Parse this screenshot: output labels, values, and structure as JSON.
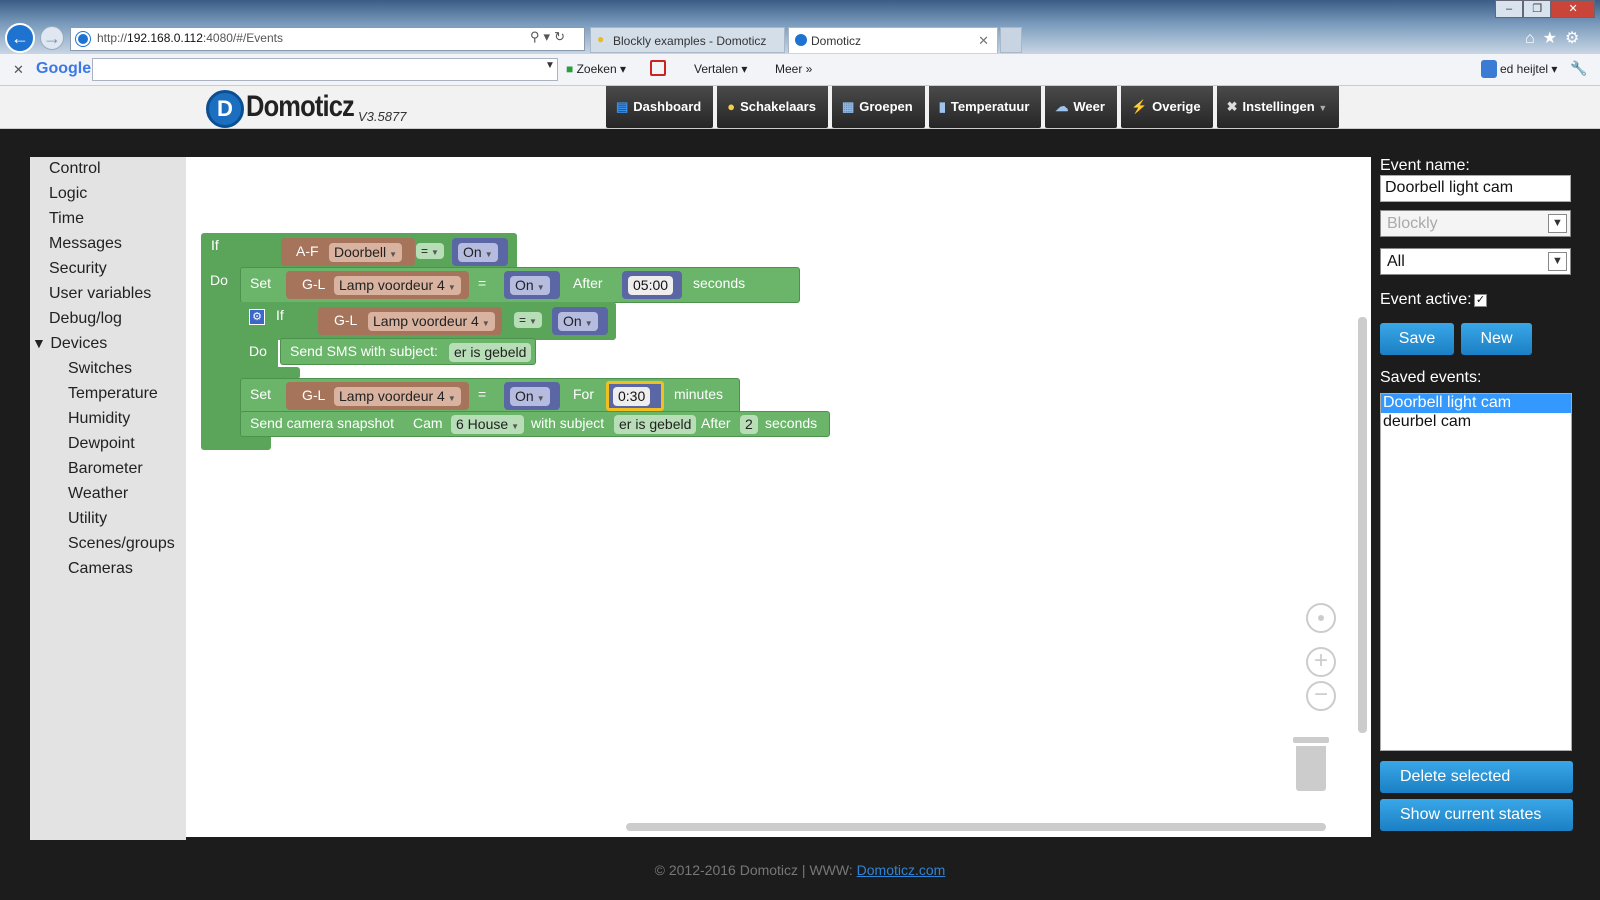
{
  "browser": {
    "url_prefix": "http://",
    "url_host": "192.168.0.112",
    "url_rest": ":4080/#/Events",
    "tabs": [
      {
        "label": "Blockly examples - Domoticz"
      },
      {
        "label": "Domoticz"
      }
    ],
    "toolbar": {
      "google": "Google",
      "zoeken": "Zoeken",
      "vertalen": "Vertalen",
      "meer": "Meer",
      "user": "ed heijtel"
    }
  },
  "app": {
    "logo": "Domoticz",
    "version": "V3.5877",
    "nav": [
      {
        "label": "Dashboard",
        "icon": "dashboard-icon"
      },
      {
        "label": "Schakelaars",
        "icon": "lightbulb-icon"
      },
      {
        "label": "Groepen",
        "icon": "groups-icon"
      },
      {
        "label": "Temperatuur",
        "icon": "thermometer-icon"
      },
      {
        "label": "Weer",
        "icon": "weather-icon"
      },
      {
        "label": "Overige",
        "icon": "utility-icon"
      },
      {
        "label": "Instellingen",
        "icon": "settings-icon"
      }
    ]
  },
  "sidebar": {
    "categories": [
      "Control",
      "Logic",
      "Time",
      "Messages",
      "Security",
      "User variables",
      "Debug/log",
      "Devices"
    ],
    "devices": [
      "Switches",
      "Temperature",
      "Humidity",
      "Dewpoint",
      "Barometer",
      "Weather",
      "Utility",
      "Scenes/groups",
      "Cameras"
    ]
  },
  "blocks": {
    "if": "If",
    "do": "Do",
    "set": "Set",
    "af": "A-F",
    "doorbell": "Doorbell",
    "eq": "=",
    "on": "On",
    "gl": "G-L",
    "lamp": "Lamp voordeur 4",
    "after": "After",
    "time1": "05:00",
    "seconds": "seconds",
    "sms": "Send SMS with subject:",
    "sms_subject": "er is gebeld",
    "for": "For",
    "time2": "0:30",
    "minutes": "minutes",
    "snapshot": "Send camera snapshot",
    "cam": "Cam",
    "house": "6 House",
    "with_subject": "with subject",
    "snap_subject": "er is gebeld",
    "snap_after": "After",
    "snap_num": "2",
    "snap_seconds": "seconds"
  },
  "panel": {
    "event_name_label": "Event name:",
    "event_name": "Doorbell light cam",
    "interpreter": "Blockly",
    "trigger": "All",
    "event_active_label": "Event active:",
    "save": "Save",
    "new": "New",
    "saved_events_label": "Saved events:",
    "saved_events": [
      "Doorbell light cam",
      "deurbel cam"
    ],
    "delete_selected": "Delete selected",
    "show_states": "Show current states"
  },
  "footer": {
    "text": "© 2012-2016 Domoticz | WWW: ",
    "link": "Domoticz.com"
  }
}
